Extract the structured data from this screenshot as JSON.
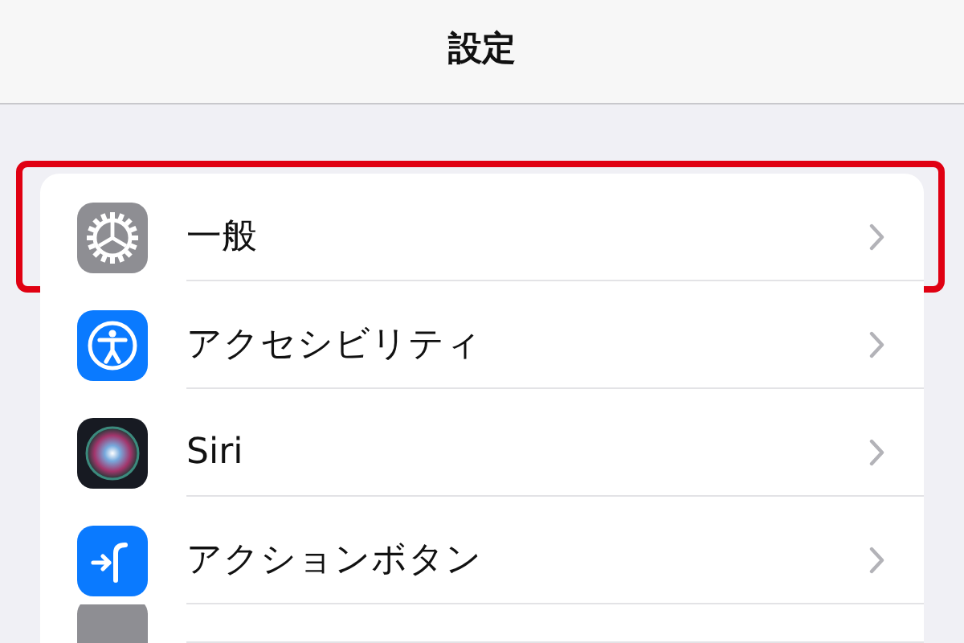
{
  "nav_bar": {
    "title": "設定"
  },
  "settings": [
    {
      "kind": "general",
      "label": "一般",
      "highlighted": true
    },
    {
      "kind": "accessibility",
      "label": "アクセシビリティ",
      "highlighted": false
    },
    {
      "kind": "siri",
      "label": "Siri",
      "highlighted": false
    },
    {
      "kind": "action",
      "label": "アクションボタン",
      "highlighted": false
    },
    {
      "kind": "partial"
    }
  ]
}
